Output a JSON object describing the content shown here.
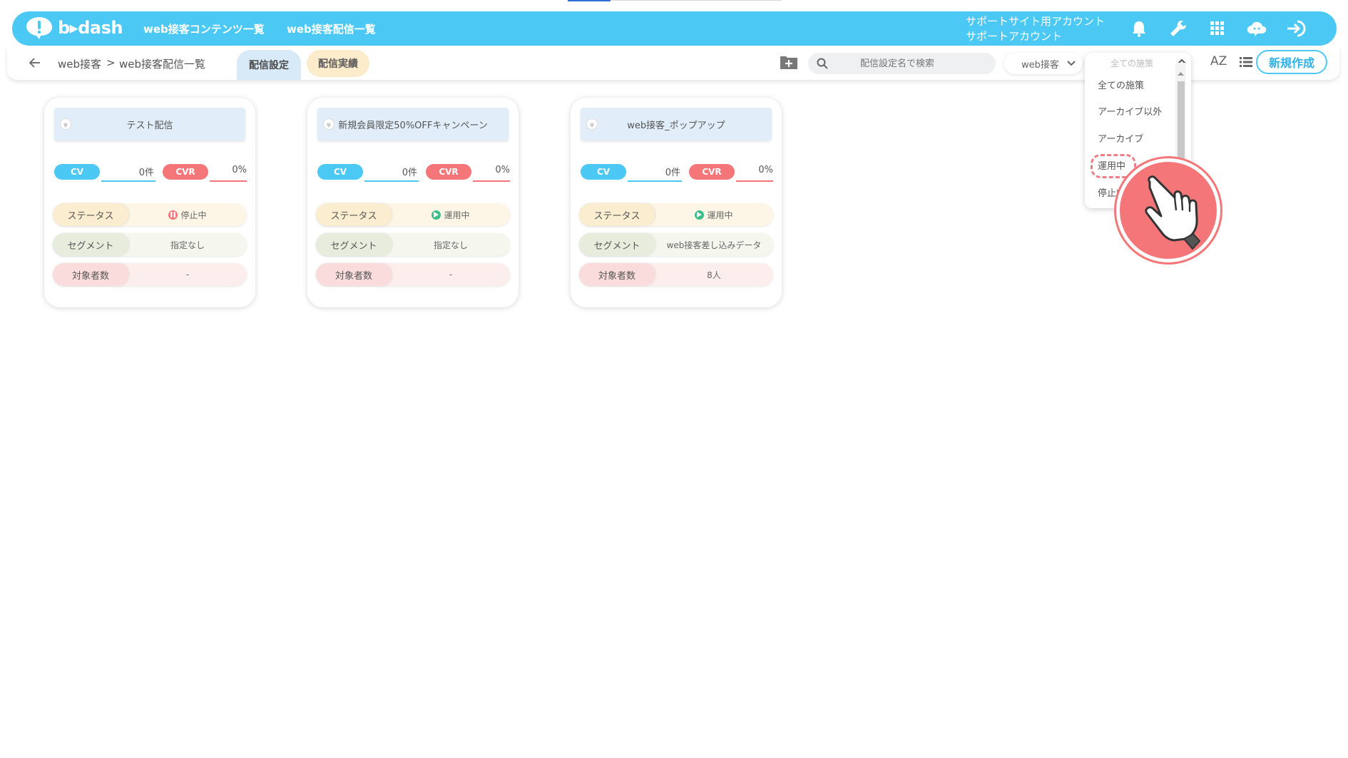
{
  "header": {
    "logo_text": "b▸dash",
    "nav": [
      "web接客コンテンツ一覧",
      "web接客配信一覧"
    ],
    "account_line1": "サポートサイト用アカウント",
    "account_line2": "サポートアカウント",
    "icons": [
      "bell-icon",
      "wrench-icon",
      "grid-icon",
      "cloud-chat-icon",
      "logout-icon"
    ]
  },
  "subbar": {
    "breadcrumb_root": "web接客",
    "breadcrumb_sep": ">",
    "breadcrumb_current": "web接客配信一覧",
    "tab_active": "配信設定",
    "tab_other": "配信実績",
    "search_placeholder": "配信設定名で検索",
    "channel_select": "web接客",
    "sort_label": "AZ",
    "new_button": "新規作成"
  },
  "dropdown": {
    "selected": "全ての施策",
    "options": [
      "全ての施策",
      "アーカイブ以外",
      "アーカイブ",
      "運用中",
      "停止中"
    ],
    "highlighted": "運用中"
  },
  "labels": {
    "cv": "CV",
    "cvr": "CVR",
    "status": "ステータス",
    "segment": "セグメント",
    "target": "対象者数"
  },
  "cards": [
    {
      "title": "テスト配信",
      "cv": "0件",
      "cvr": "0%",
      "status": "停止中",
      "status_type": "paused",
      "segment": "指定なし",
      "target": "-"
    },
    {
      "title": "新規会員限定50%OFFキャンペーン",
      "cv": "0件",
      "cvr": "0%",
      "status": "運用中",
      "status_type": "running",
      "segment": "指定なし",
      "target": "-"
    },
    {
      "title": "web接客_ポップアップ",
      "cv": "0件",
      "cvr": "0%",
      "status": "運用中",
      "status_type": "running",
      "segment": "web接客差し込みデータ",
      "target": "8人"
    }
  ],
  "colors": {
    "header": "#4cc8f5",
    "cv": "#4cc8f5",
    "cvr": "#f47678",
    "running": "#3bbf8a",
    "paused": "#f47678"
  }
}
